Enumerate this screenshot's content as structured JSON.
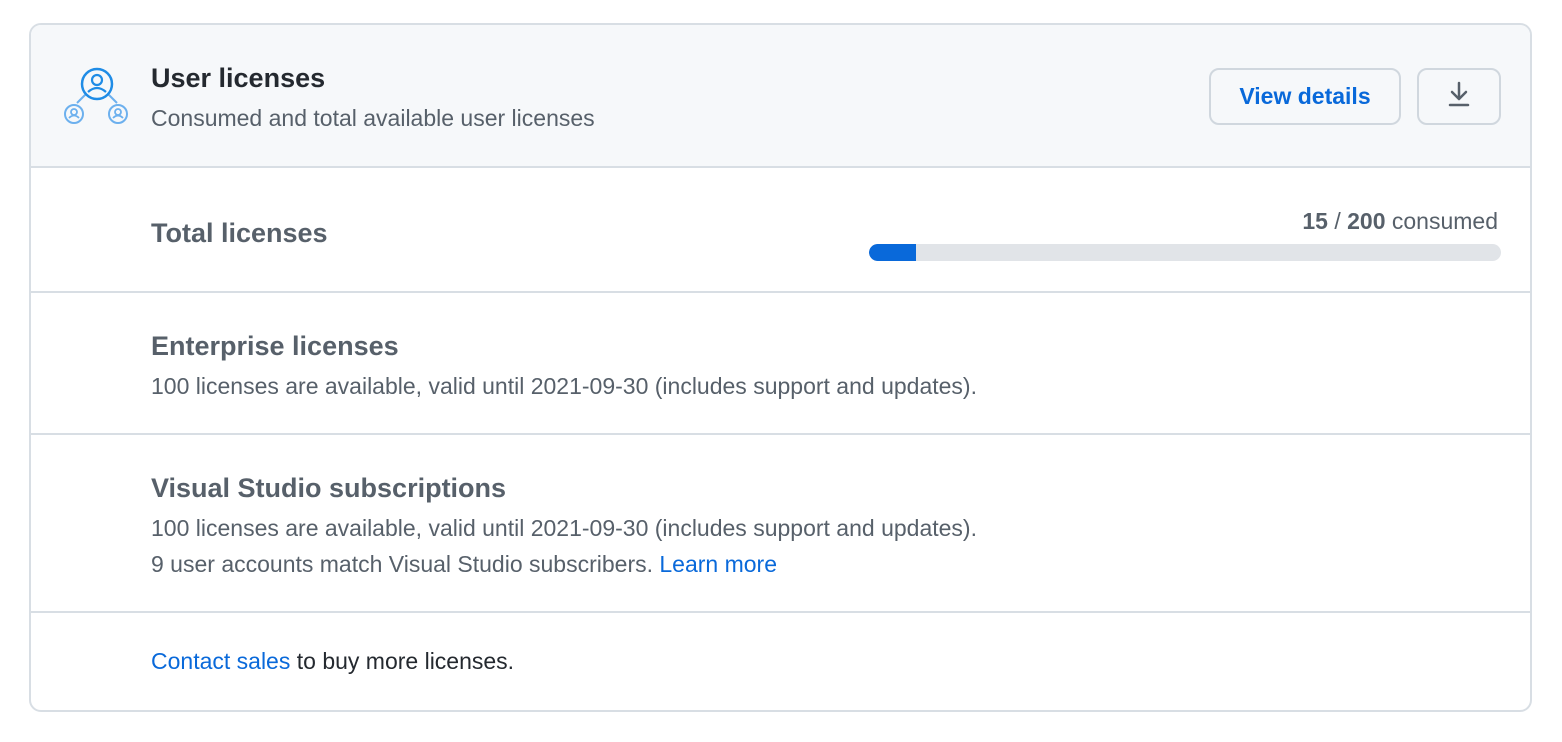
{
  "header": {
    "icon": "users-network-icon",
    "title": "User licenses",
    "subtitle": "Consumed and total available user licenses",
    "view_details_label": "View details",
    "download_icon": "download-icon"
  },
  "total": {
    "heading": "Total licenses",
    "consumed_count": "15",
    "separator": " / ",
    "total_count": "200",
    "consumed_suffix": " consumed",
    "progress_fraction": 0.075
  },
  "enterprise": {
    "heading": "Enterprise licenses",
    "description": "100 licenses are available, valid until 2021-09-30 (includes support and updates)."
  },
  "visual_studio": {
    "heading": "Visual Studio subscriptions",
    "description": "100 licenses are available, valid until 2021-09-30 (includes support and updates).",
    "match_text": "9 user accounts match Visual Studio subscribers. ",
    "learn_more_label": "Learn more"
  },
  "contact": {
    "link_label": "Contact sales",
    "suffix": " to buy more licenses."
  },
  "colors": {
    "accent": "#0969da",
    "icon_blue": "#1f8ce6",
    "progress_track": "#e1e4e8"
  }
}
